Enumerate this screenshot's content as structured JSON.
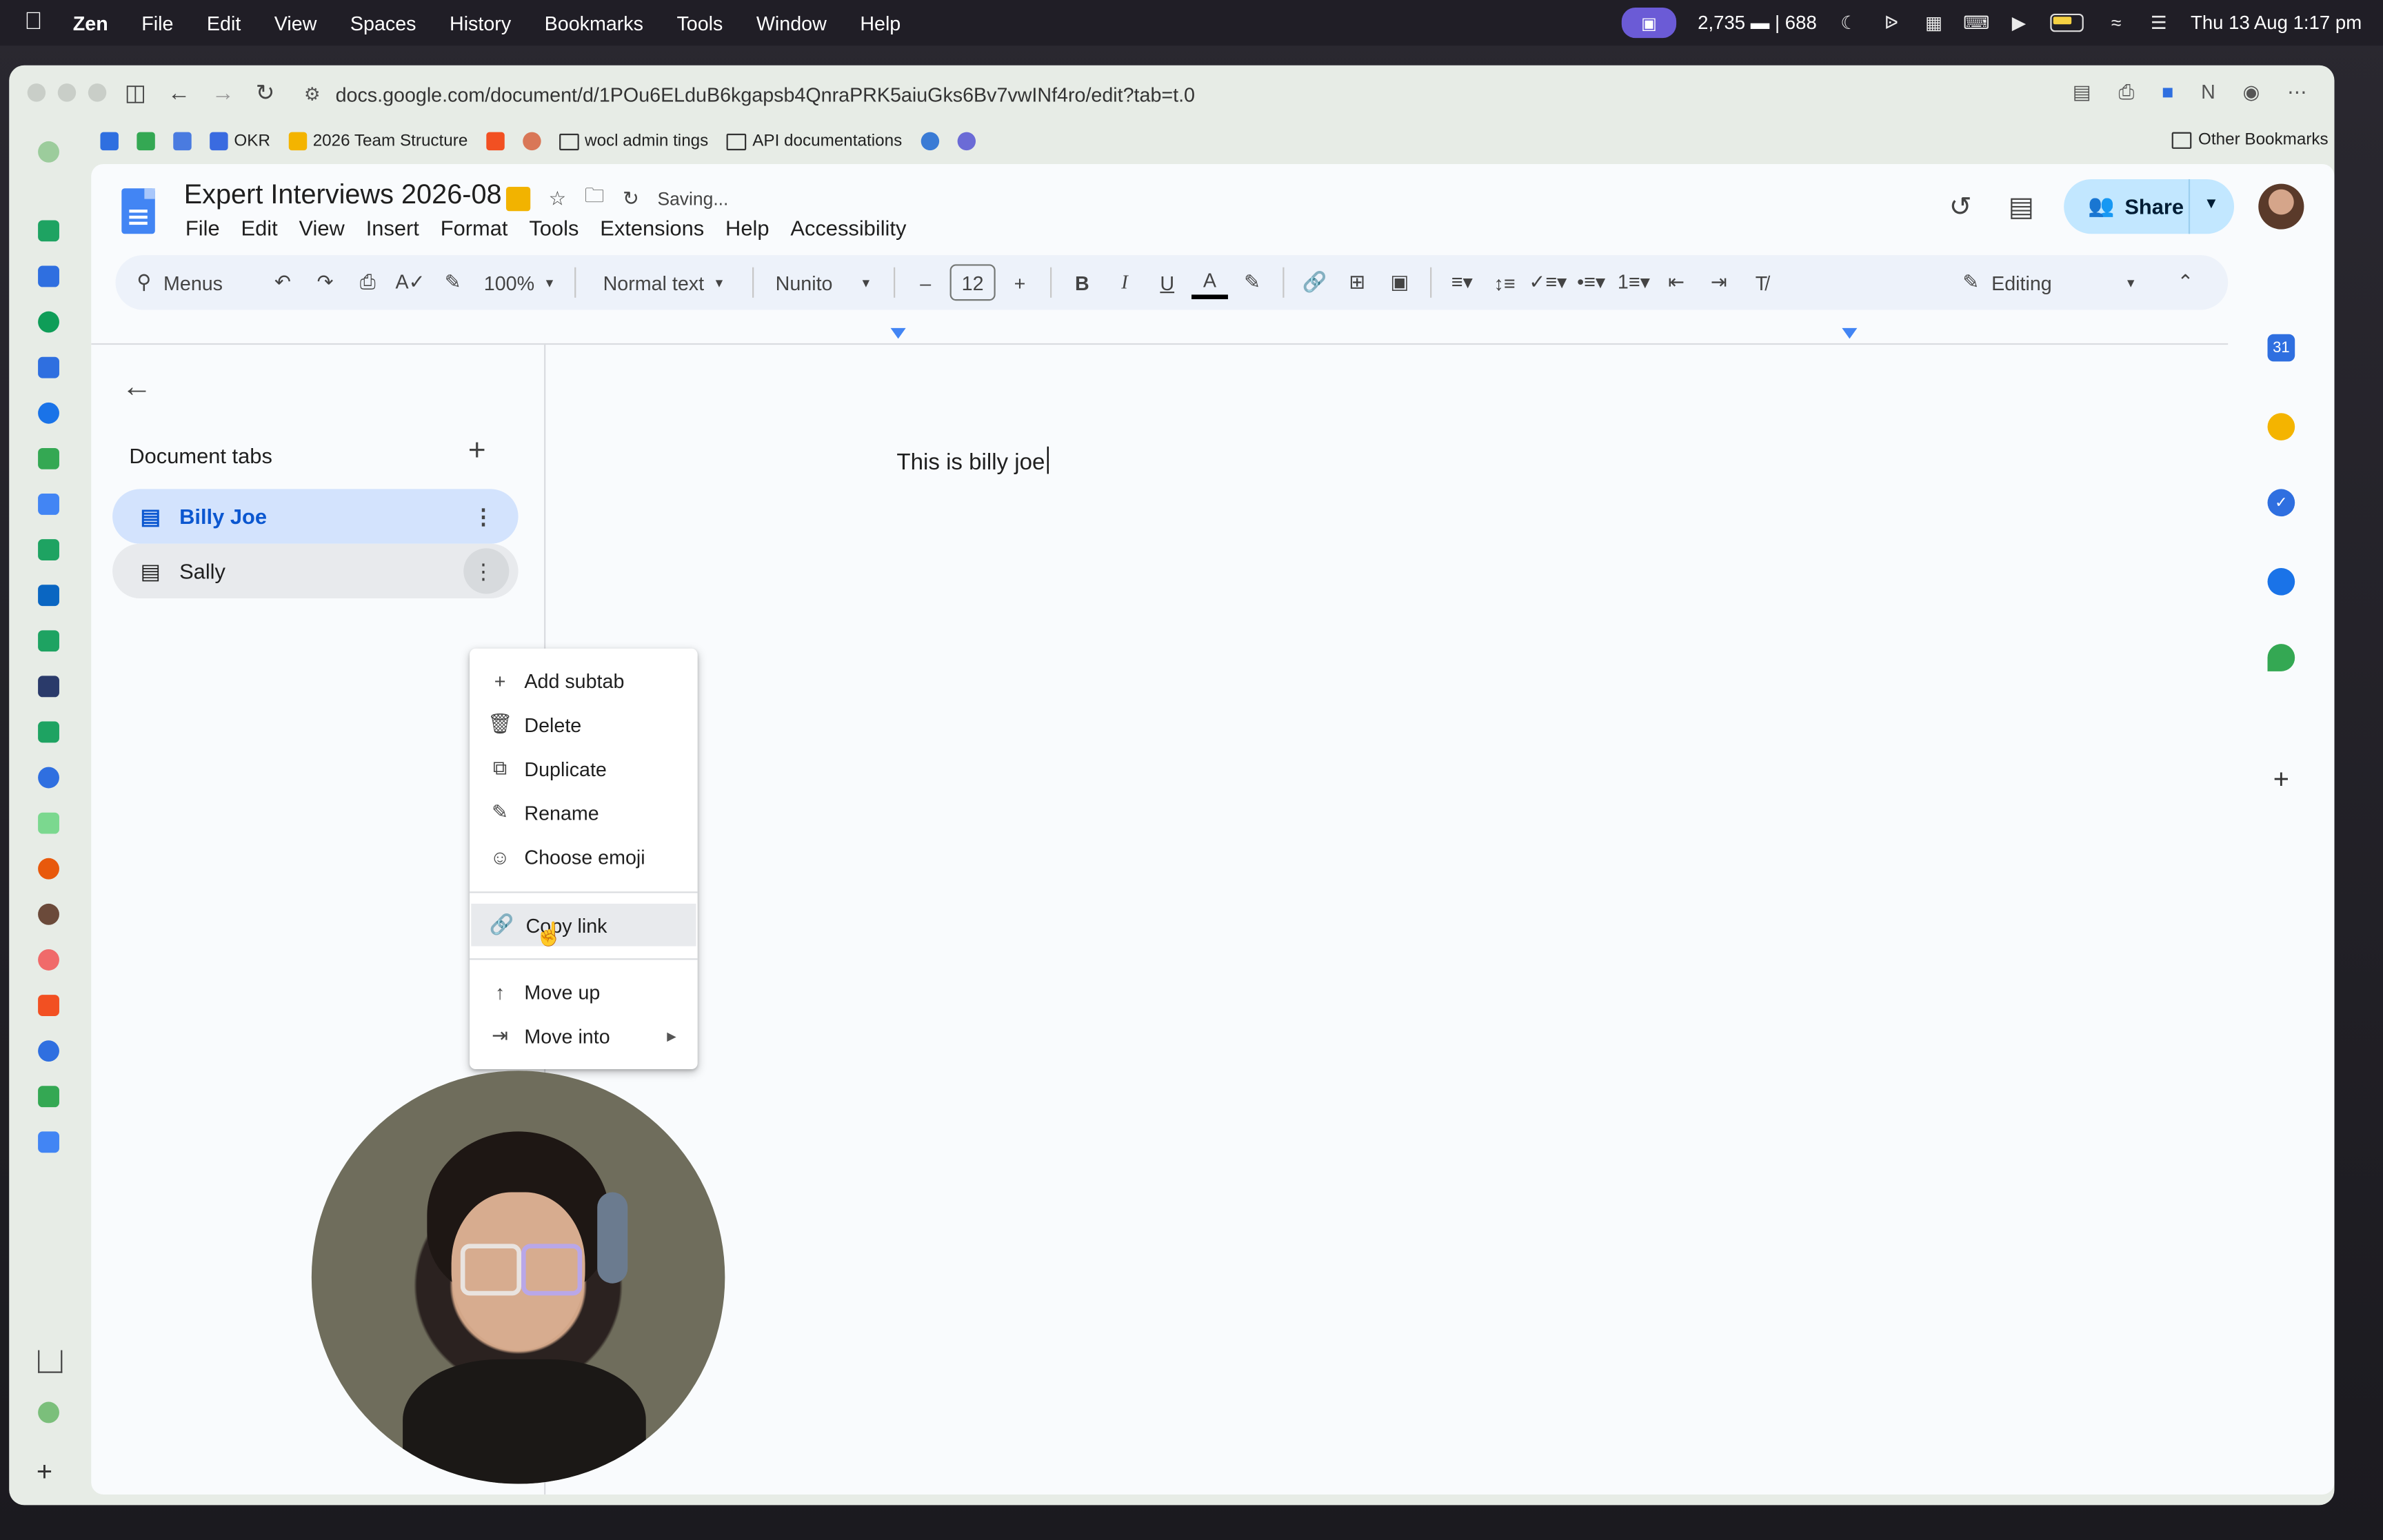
{
  "menubar": {
    "app": "Zen",
    "items": [
      "File",
      "Edit",
      "View",
      "Spaces",
      "History",
      "Bookmarks",
      "Tools",
      "Window",
      "Help"
    ],
    "stats": "2,735 ▬ | 688",
    "datetime": "Thu 13 Aug  1:17 pm"
  },
  "browser": {
    "url": "docs.google.com/document/d/1POu6ELduB6kgapsb4QnraPRK5aiuGks6Bv7vwINf4ro/edit?tab=t.0",
    "bookmarks": [
      {
        "label": "",
        "color": "#2f6fe0"
      },
      {
        "label": "",
        "color": "#34a853"
      },
      {
        "label": "",
        "color": "#4a7be0"
      },
      {
        "label": "OKR",
        "color": "#3a6be0"
      },
      {
        "label": "2026 Team Structure",
        "color": "#f4b400"
      },
      {
        "label": "",
        "color": "#f25022"
      },
      {
        "label": "",
        "color": "#d97757"
      },
      {
        "label": "wocl admin tings",
        "color": "folder"
      },
      {
        "label": "API documentations",
        "color": "folder"
      },
      {
        "label": "",
        "color": "#3a7bd5"
      },
      {
        "label": "",
        "color": "#6b6bd6"
      }
    ],
    "other_bookmarks": "Other Bookmarks"
  },
  "docs": {
    "title": "Expert Interviews 2026-08",
    "status": "Saving...",
    "menu": [
      "File",
      "Edit",
      "View",
      "Insert",
      "Format",
      "Tools",
      "Extensions",
      "Help",
      "Accessibility"
    ],
    "share_label": "Share",
    "toolbar": {
      "menus_label": "Menus",
      "zoom": "100%",
      "style": "Normal text",
      "font": "Nunito",
      "font_size": "12",
      "mode": "Editing"
    },
    "side_panel": {
      "title": "Document tabs",
      "tabs": [
        {
          "label": "Billy Joe",
          "active": true
        },
        {
          "label": "Sally",
          "active": false
        }
      ]
    },
    "body_text": "This is billy joe",
    "context_menu": {
      "items": [
        {
          "label": "Add subtab",
          "icon": "plus-icon"
        },
        {
          "label": "Delete",
          "icon": "trash-icon"
        },
        {
          "label": "Duplicate",
          "icon": "copy-icon"
        },
        {
          "label": "Rename",
          "icon": "pencil-icon"
        },
        {
          "label": "Choose emoji",
          "icon": "emoji-icon"
        },
        {
          "label": "Copy link",
          "icon": "link-icon",
          "highlighted": true
        },
        {
          "label": "Move up",
          "icon": "arrow-up-icon"
        },
        {
          "label": "Move into",
          "icon": "move-into-icon",
          "submenu": true
        }
      ]
    },
    "right_rail_date": "31"
  },
  "colors": {
    "accent": "#0b57d0",
    "share_bg": "#c2e7ff",
    "active_tab_bg": "#d3e3fd",
    "docs_blue": "#4285f4"
  }
}
